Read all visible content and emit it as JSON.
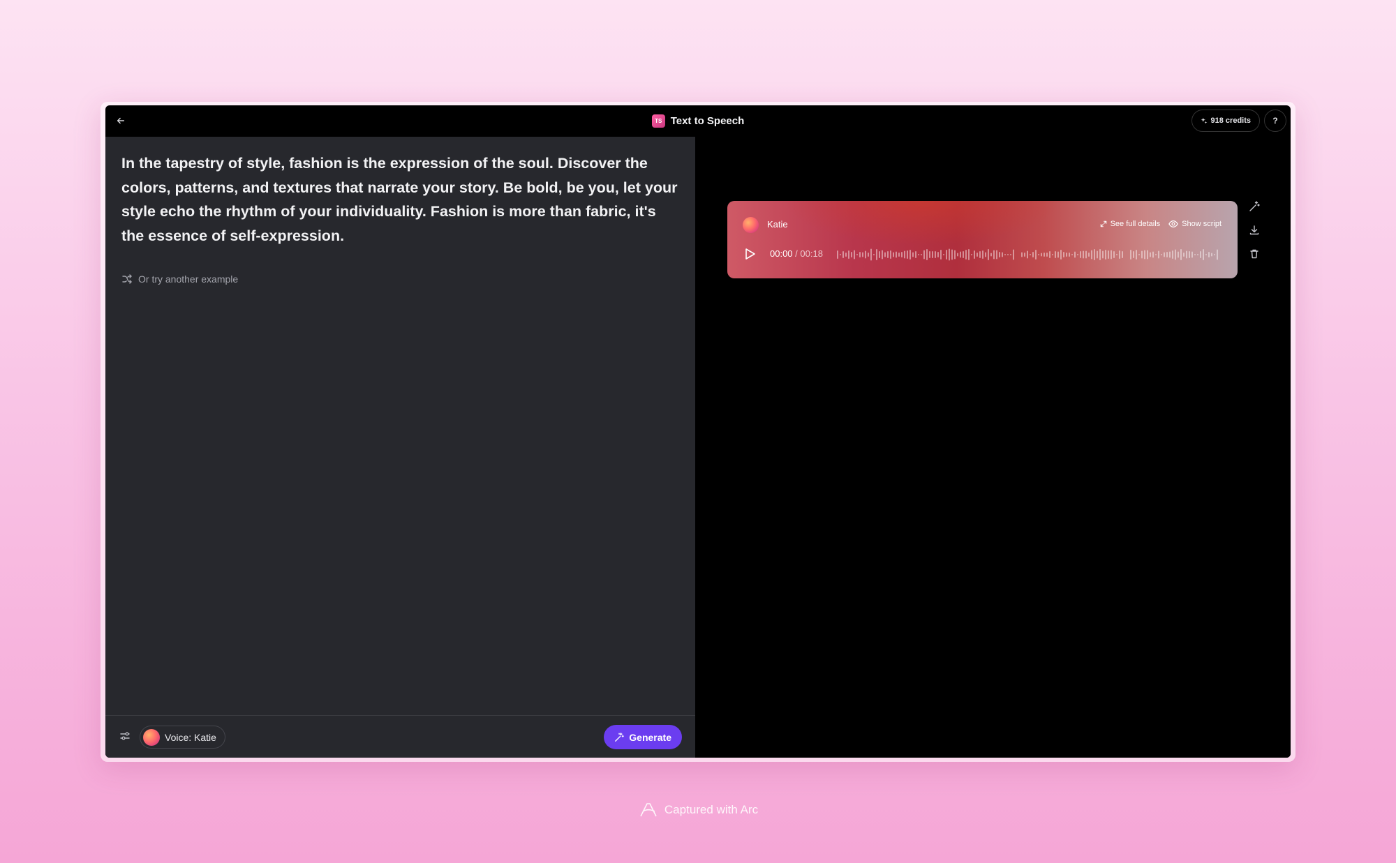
{
  "topbar": {
    "title": "Text to Speech",
    "app_badge": "TS",
    "credits": "918 credits",
    "help": "?"
  },
  "editor": {
    "text": "In the tapestry of style, fashion is the expression of the soul. Discover the colors, patterns, and textures that narrate your story. Be bold, be you, let your style echo the rhythm of your individuality. Fashion is more than fabric, it's the essence of self-expression.",
    "example_link": "Or try another example"
  },
  "footer": {
    "voice_label": "Voice: Katie",
    "generate_label": "Generate"
  },
  "player": {
    "voice_name": "Katie",
    "see_full_details": "See full details",
    "show_script": "Show script",
    "current_time": "00:00",
    "separator": " / ",
    "duration": "00:18",
    "progress": 0
  },
  "watermark": "Captured with Arc",
  "colors": {
    "background_top": "#fde3f3",
    "background_bottom": "#f5a6d6",
    "editor_bg": "#27282d",
    "generate_button": "#6b3df0",
    "player_red": "#b02f3d"
  },
  "icons": {
    "back": "arrow-left-icon",
    "credits": "sparkle-icon",
    "example": "shuffle-icon",
    "settings": "sliders-icon",
    "generate": "magic-wand-icon",
    "see_details": "expand-icon",
    "show_script": "eye-icon",
    "play": "play-icon",
    "side_tools": [
      "magic-wand-icon",
      "download-icon",
      "trash-icon"
    ]
  }
}
